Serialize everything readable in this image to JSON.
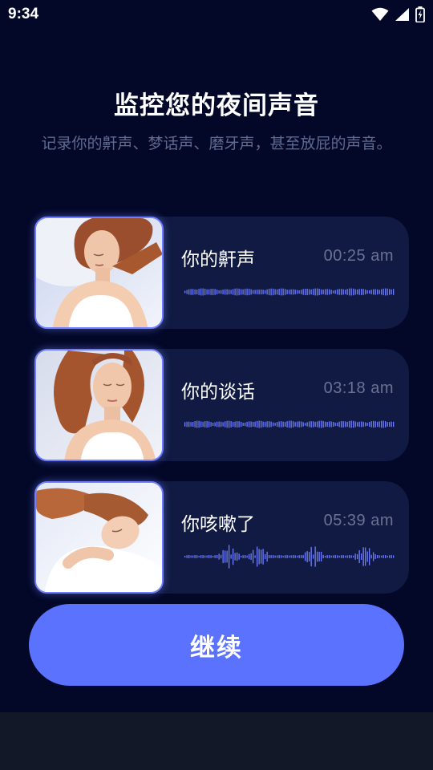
{
  "status_bar": {
    "time": "9:34"
  },
  "title": "监控您的夜间声音",
  "subtitle": "记录你的鼾声、梦话声、磨牙声，甚至放屁的声音。",
  "cards": [
    {
      "label": "你的鼾声",
      "time": "00:25 am",
      "photo": "sleeping-woman-photo-1"
    },
    {
      "label": "你的谈话",
      "time": "03:18 am",
      "photo": "sleeping-woman-photo-2"
    },
    {
      "label": "你咳嗽了",
      "time": "05:39 am",
      "photo": "sleeping-woman-photo-3"
    }
  ],
  "continue_label": "继续",
  "colors": {
    "background": "#030828",
    "card": "#101a42",
    "accent": "#5b72ff",
    "waveform": "#6f7dff",
    "subtitle": "#5f6a90",
    "time_text": "#6a7294"
  }
}
